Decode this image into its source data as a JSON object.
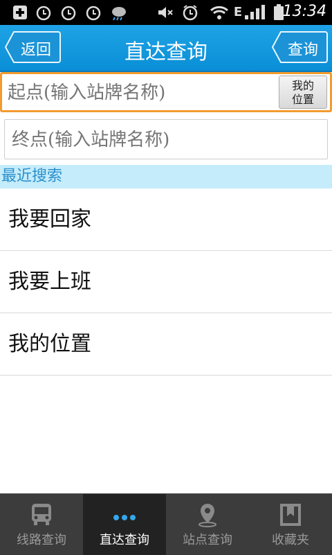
{
  "status_bar": {
    "time": "13:34",
    "network": "E",
    "icons": [
      "add-notification-icon",
      "alarm-icon",
      "alarm-icon",
      "alarm-icon",
      "weather-icon",
      "mute-icon",
      "alarm-clock-icon",
      "wifi-icon",
      "signal-icon",
      "battery-icon"
    ]
  },
  "header": {
    "back_label": "返回",
    "title": "直达查询",
    "query_label": "查询"
  },
  "search": {
    "start_placeholder": "起点(输入站牌名称)",
    "start_value": "",
    "end_placeholder": "终点(输入站牌名称)",
    "end_value": "",
    "my_location_line1": "我的",
    "my_location_line2": "位置"
  },
  "recent": {
    "header": "最近搜索",
    "items": [
      "我要回家",
      "我要上班",
      "我的位置"
    ]
  },
  "tabs": [
    {
      "label": "线路查询",
      "icon": "bus-icon",
      "active": false
    },
    {
      "label": "直达查询",
      "icon": "dots-icon",
      "active": true
    },
    {
      "label": "站点查询",
      "icon": "location-pin-icon",
      "active": false
    },
    {
      "label": "收藏夹",
      "icon": "bookmark-icon",
      "active": false
    }
  ],
  "colors": {
    "header": "#1199e0",
    "input_focus": "#f29a2e",
    "recent_header_bg": "#c4ecfb",
    "tabbar_bg": "#3c3c3c"
  }
}
